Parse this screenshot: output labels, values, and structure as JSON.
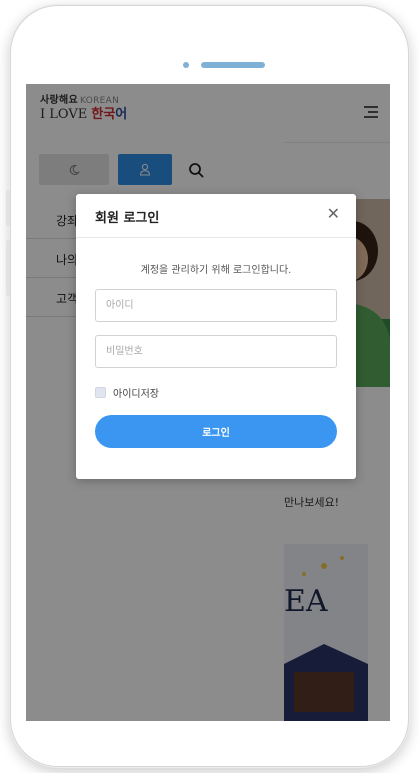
{
  "header": {
    "logo_line1": "사랑해요",
    "logo_line1_accent": "KOREAN",
    "logo_line2": "I LOVE",
    "logo_line2_red": "한국",
    "logo_line2_blue": "어"
  },
  "sidemenu": {
    "toolbar": {
      "theme_icon": "moon-icon",
      "user_icon": "user-icon",
      "search_icon": "search-icon"
    },
    "items": [
      {
        "label": "강좌"
      },
      {
        "label": "나의"
      },
      {
        "label": "고객"
      }
    ]
  },
  "background": {
    "promo_text": "만나보세요!",
    "card_text": "EA"
  },
  "modal": {
    "title": "회원 로그인",
    "description": "계정을 관리하기 위해 로그인합니다.",
    "id_placeholder": "아이디",
    "password_placeholder": "비밀번호",
    "remember_label": "아이디저장",
    "login_label": "로그인",
    "close_icon": "close-icon"
  },
  "colors": {
    "accent": "#3a96f0",
    "overlay": "rgba(0,0,0,0.45)",
    "device_dots": "#7fb0d6"
  }
}
